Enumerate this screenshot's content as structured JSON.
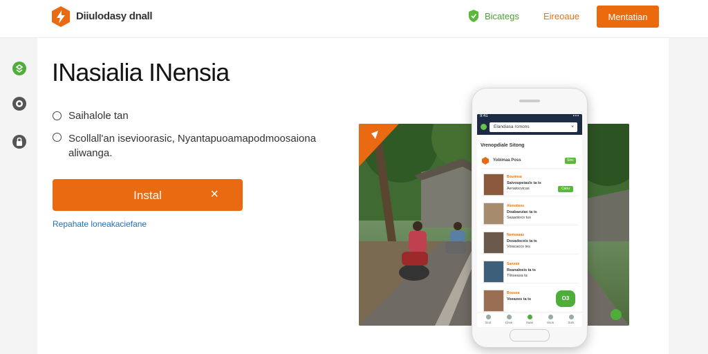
{
  "header": {
    "brand": "Diiulodasy dnall",
    "nav_link_1": "Bicategs",
    "nav_link_2": "Eireoaue",
    "cta": "Mentatian"
  },
  "main": {
    "title": "INasialia INensia",
    "options": [
      "Saihalole tan",
      "Scollall'an isevioorasic, Nyantapuoamapodmoosaiona aliwanga."
    ],
    "install_button": "Instal",
    "secondary_link": "Repahate loneakaciefane"
  },
  "phone": {
    "status_time": "9:41",
    "status_signal": "▪▪▪",
    "search_text": "Elandiasa rcmons",
    "search_close": "×",
    "section_title": "Vrenopdiale Sitong",
    "list_header_title": "Yobimaa Poss",
    "list_header_badge": "Sinc",
    "contacts": [
      {
        "name": "Bourmsa",
        "line": "Saivoupeiauls ta ts",
        "line2": "Aenatocvicas",
        "tag": "Canu"
      },
      {
        "name": "Alenoiiees",
        "line": "Doabaeuiac ta ts",
        "line2": "Saaantocs tus"
      },
      {
        "name": "Nemosaas",
        "line": "Dosadoceis ta ts",
        "line2": "Voiacacco tes"
      },
      {
        "name": "Sarunie",
        "line": "Reanaloeis ta ts",
        "line2": "Tlinseaxa ta"
      },
      {
        "name": "Bouusa",
        "line": "Voeaoes ta ts",
        "line2": ""
      }
    ],
    "fab_label": "O3",
    "bottom_nav": [
      "Scol",
      "Cnse",
      "Saas",
      "Ssos",
      "Suts"
    ]
  },
  "colors": {
    "accent": "#e96a10",
    "green": "#4fae3a",
    "link_blue": "#1f6fb5",
    "app_bar": "#1d2b45"
  },
  "icons": {
    "logo": "flame-logo-icon",
    "nav_1": "shield-icon",
    "rail": [
      "chat-icon",
      "settings-icon",
      "lock-icon"
    ],
    "close": "close-icon"
  }
}
